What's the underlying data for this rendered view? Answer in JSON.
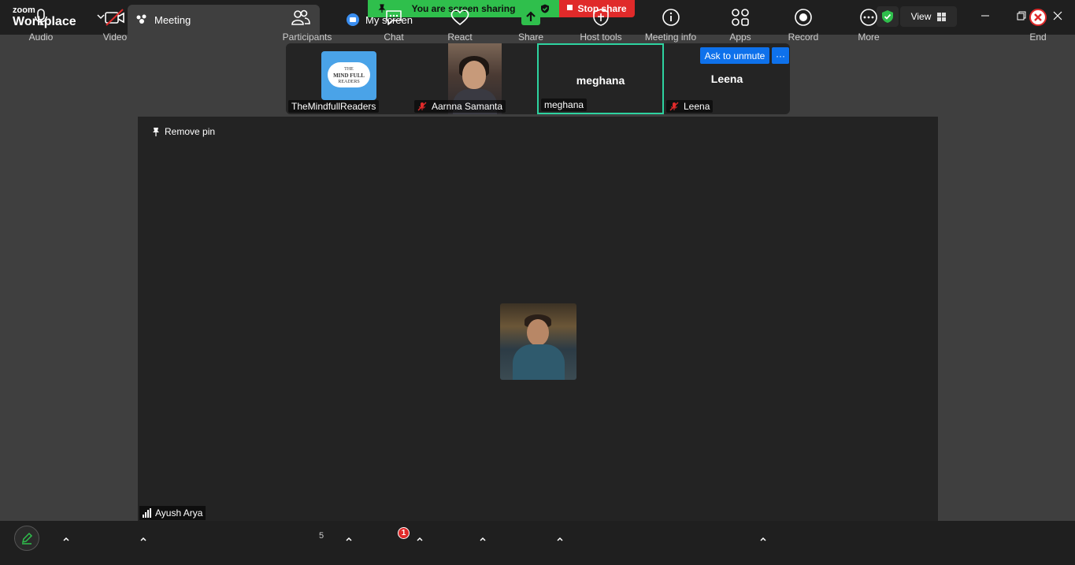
{
  "app": {
    "logo_line1": "zoom",
    "logo_line2": "Workplace"
  },
  "tabs": [
    {
      "label": "Meeting",
      "active": true
    },
    {
      "label": "My screen",
      "active": false
    }
  ],
  "banner": {
    "sharing_text": "You are screen sharing",
    "stop_label": "Stop share"
  },
  "titlebar": {
    "view_label": "View"
  },
  "colors": {
    "accent_blue": "#0e71eb",
    "share_green": "#2fbf4c",
    "stop_red": "#e02a2a",
    "active_speaker_border": "#2ed3a0",
    "end_red": "#e02a2a"
  },
  "gallery": {
    "tiles": [
      {
        "name": "TheMindfullReaders",
        "muted": false,
        "image_text_line1": "THE",
        "image_text_line2": "MIND FULL",
        "image_text_line3": "READERS"
      },
      {
        "name": "Aarnna  Samanta",
        "muted": true
      },
      {
        "name": "meghana",
        "center_name": "meghana",
        "muted": false,
        "active": true
      },
      {
        "name": "Leena",
        "center_name": "Leena",
        "muted": true
      }
    ],
    "ask_to_unmute": "Ask to unmute",
    "more_label": "···"
  },
  "main_view": {
    "remove_pin": "Remove pin",
    "speaker_name": "Ayush Arya"
  },
  "toolbar": {
    "audio": "Audio",
    "video": "Video",
    "participants": "Participants",
    "participants_count": "5",
    "chat": "Chat",
    "chat_badge": "1",
    "react": "React",
    "share": "Share",
    "host_tools": "Host tools",
    "meeting_info": "Meeting info",
    "apps": "Apps",
    "record": "Record",
    "more": "More",
    "end": "End"
  }
}
